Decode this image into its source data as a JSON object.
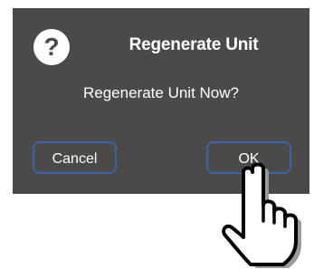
{
  "dialog": {
    "icon": "question-icon",
    "icon_glyph": "?",
    "title": "Regenerate Unit",
    "message": "Regenerate Unit Now?",
    "cancel_label": "Cancel",
    "ok_label": "OK"
  },
  "overlay": {
    "icon": "pointing-hand-icon"
  },
  "colors": {
    "dialog_background": "#4b4a49",
    "button_border": "#3c63ab",
    "text": "#ffffff"
  }
}
